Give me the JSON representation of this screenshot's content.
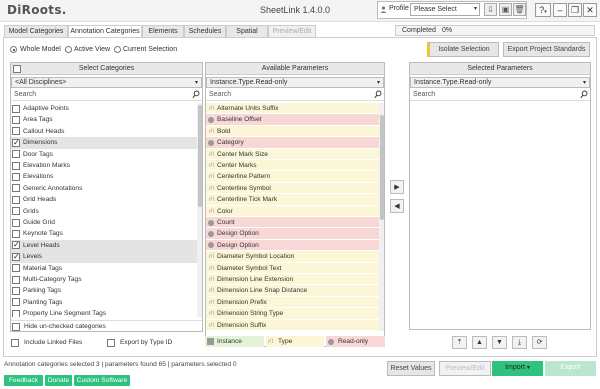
{
  "app": {
    "logo": "DiRoots.",
    "title": "SheetLink 1.4.0.0",
    "profile_label": "Profile",
    "profile_value": "Please Select",
    "help": "?"
  },
  "tabs": [
    {
      "label": "Model Categories"
    },
    {
      "label": "Annotation Categories"
    },
    {
      "label": "Elements"
    },
    {
      "label": "Schedules"
    },
    {
      "label": "Spatial"
    },
    {
      "label": "Preview/Edit"
    }
  ],
  "progress": {
    "label": "Completed",
    "value": "0%"
  },
  "scope": {
    "options": [
      "Whole Model",
      "Active View",
      "Current Selection"
    ],
    "selected": "Whole Model"
  },
  "toolbar": {
    "isolate": "Isolate Selection",
    "export_standards": "Export Project Standards"
  },
  "categories": {
    "header": "Select Categories",
    "discipline": "<All Disciplines>",
    "search_placeholder": "Search",
    "items": [
      {
        "label": "Adaptive Points",
        "checked": false,
        "sel": false
      },
      {
        "label": "Area Tags",
        "checked": false,
        "sel": false
      },
      {
        "label": "Callout Heads",
        "checked": false,
        "sel": false
      },
      {
        "label": "Dimensions",
        "checked": true,
        "sel": true
      },
      {
        "label": "Door Tags",
        "checked": false,
        "sel": false
      },
      {
        "label": "Elevation Marks",
        "checked": false,
        "sel": false
      },
      {
        "label": "Elevations",
        "checked": false,
        "sel": false
      },
      {
        "label": "Generic Annotations",
        "checked": false,
        "sel": false
      },
      {
        "label": "Grid Heads",
        "checked": false,
        "sel": false
      },
      {
        "label": "Grids",
        "checked": false,
        "sel": false
      },
      {
        "label": "Guide Grid",
        "checked": false,
        "sel": false
      },
      {
        "label": "Keynote Tags",
        "checked": false,
        "sel": false
      },
      {
        "label": "Level Heads",
        "checked": true,
        "sel": true
      },
      {
        "label": "Levels",
        "checked": true,
        "sel": true
      },
      {
        "label": "Material Tags",
        "checked": false,
        "sel": false
      },
      {
        "label": "Multi-Category Tags",
        "checked": false,
        "sel": false
      },
      {
        "label": "Parking Tags",
        "checked": false,
        "sel": false
      },
      {
        "label": "Planting Tags",
        "checked": false,
        "sel": false
      },
      {
        "label": "Property Line Segment Tags",
        "checked": false,
        "sel": false
      }
    ],
    "hide_unchecked": "Hide un-checked categories",
    "include_linked": "Include Linked Files",
    "export_by_type": "Export by Type ID"
  },
  "available": {
    "header": "Available Parameters",
    "filter": "Instance.Type.Read-only",
    "search_placeholder": "Search",
    "items": [
      {
        "label": "Alternate Units Suffix",
        "kind": "type"
      },
      {
        "label": "Baseline Offset",
        "kind": "readonly"
      },
      {
        "label": "Bold",
        "kind": "type"
      },
      {
        "label": "Category",
        "kind": "readonly"
      },
      {
        "label": "Center Mark Size",
        "kind": "type"
      },
      {
        "label": "Center Marks",
        "kind": "type"
      },
      {
        "label": "Centerline Pattern",
        "kind": "type"
      },
      {
        "label": "Centerline Symbol",
        "kind": "type"
      },
      {
        "label": "Centerline Tick Mark",
        "kind": "type"
      },
      {
        "label": "Color",
        "kind": "type"
      },
      {
        "label": "Count",
        "kind": "readonly"
      },
      {
        "label": "Design Option",
        "kind": "readonly"
      },
      {
        "label": "Design Option",
        "kind": "readonly"
      },
      {
        "label": "Diameter Symbol Location",
        "kind": "type"
      },
      {
        "label": "Diameter Symbol Text",
        "kind": "type"
      },
      {
        "label": "Dimension Line Extension",
        "kind": "type"
      },
      {
        "label": "Dimension Line Snap Distance",
        "kind": "type"
      },
      {
        "label": "Dimension Prefix",
        "kind": "type"
      },
      {
        "label": "Dimension String Type",
        "kind": "type"
      },
      {
        "label": "Dimension Suffix",
        "kind": "type"
      },
      {
        "label": "Equality Display",
        "kind": "instance"
      }
    ]
  },
  "selected": {
    "header": "Selected Parameters",
    "filter": "Instance.Type.Read-only",
    "search_placeholder": "Search"
  },
  "legend": {
    "instance": "Instance",
    "type": "Type",
    "readonly": "Read-only"
  },
  "colors": {
    "instance": "#e4f2d8",
    "type": "#fbf6d6",
    "readonly": "#f8d7d7",
    "accent": "#2ec27e",
    "isolate_highlight": "#f0c040"
  },
  "buttons": {
    "reset": "Reset Values",
    "preview": "Preview/Edit",
    "import": "Import",
    "export": "Export"
  },
  "status": "Annotation categories selected 3 | parameters found 65 | parameters selected 0",
  "footer": {
    "feedback": "Feedback",
    "donate": "Donate",
    "custom": "Custom Software"
  }
}
